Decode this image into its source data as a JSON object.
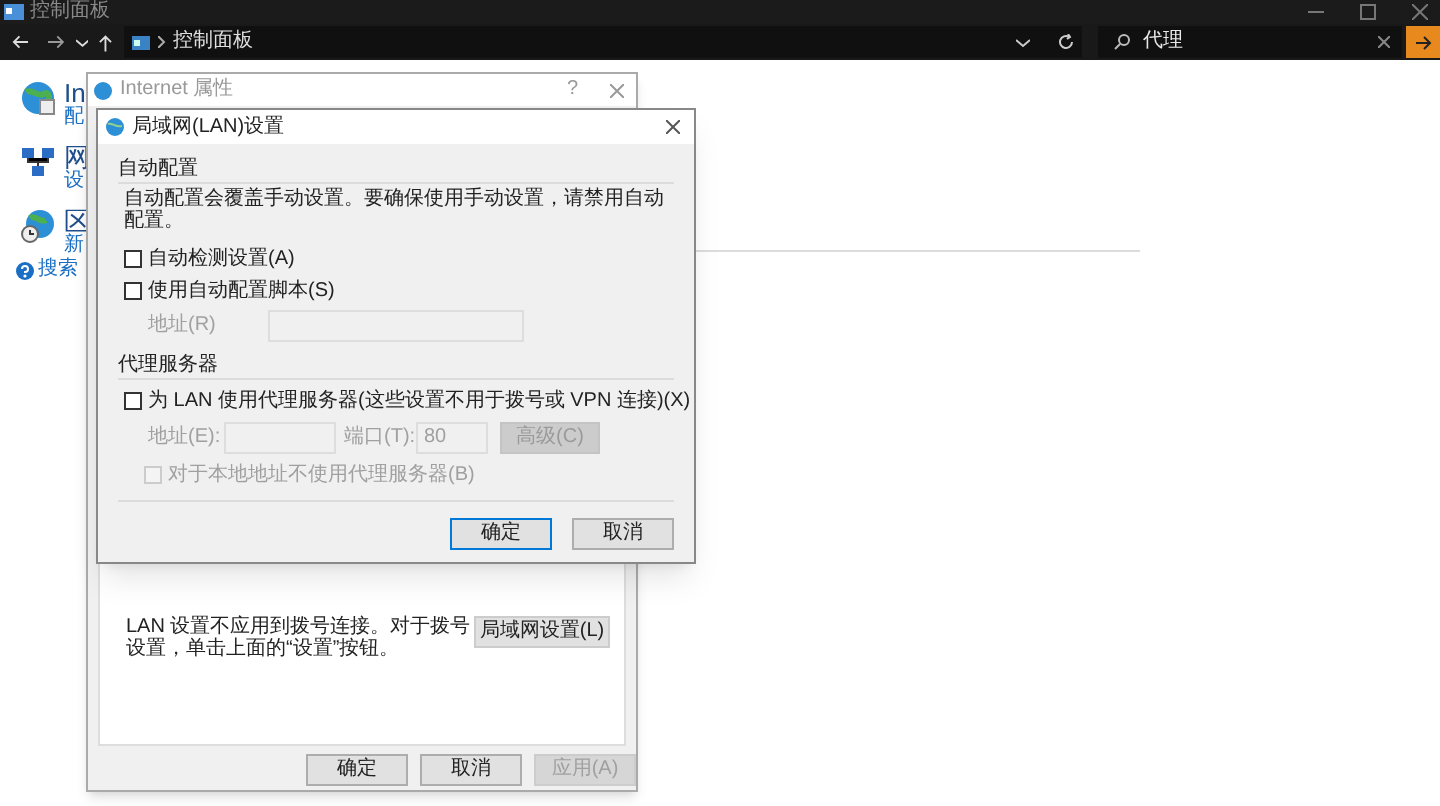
{
  "explorer": {
    "title": "控制面板",
    "address": "控制面板",
    "search_value": "代理"
  },
  "background_items": [
    {
      "title": "In",
      "subtitle": "配"
    },
    {
      "title": "网",
      "subtitle": "设"
    },
    {
      "title": "区",
      "subtitle": "新"
    }
  ],
  "help_link": "搜索",
  "internet_dialog": {
    "title": "Internet 属性",
    "help": "?",
    "lan_note": "LAN 设置不应用到拨号连接。对于拨号设置，单击上面的“设置”按钮。",
    "lan_button": "局域网设置(L)",
    "buttons": [
      {
        "label": "确定",
        "disabled": false
      },
      {
        "label": "取消",
        "disabled": false
      },
      {
        "label": "应用(A)",
        "disabled": true
      }
    ]
  },
  "lan_dialog": {
    "title": "局域网(LAN)设置",
    "auto": {
      "title": "自动配置",
      "description": "自动配置会覆盖手动设置。要确保使用手动设置，请禁用自动配置。",
      "checkboxes": [
        {
          "label": "自动检测设置(A)",
          "checked": false,
          "disabled": false
        },
        {
          "label": "使用自动配置脚本(S)",
          "checked": false,
          "disabled": false
        }
      ],
      "address_label": "地址(R)",
      "address_disabled": true
    },
    "proxy": {
      "title": "代理服务器",
      "checkbox": {
        "label": "为 LAN 使用代理服务器(这些设置不用于拨号或 VPN 连接)(X)",
        "checked": false,
        "disabled": false
      },
      "address_label": "地址(E):",
      "port_label": "端口(T):",
      "port_value": "80",
      "fields_disabled": true,
      "advanced_button": {
        "label": "高级(C)",
        "disabled": true
      },
      "bypass": {
        "label": "对于本地地址不使用代理服务器(B)",
        "checked": false,
        "disabled": true
      }
    },
    "buttons": [
      {
        "label": "确定",
        "default": true
      },
      {
        "label": "取消",
        "default": false
      }
    ]
  }
}
